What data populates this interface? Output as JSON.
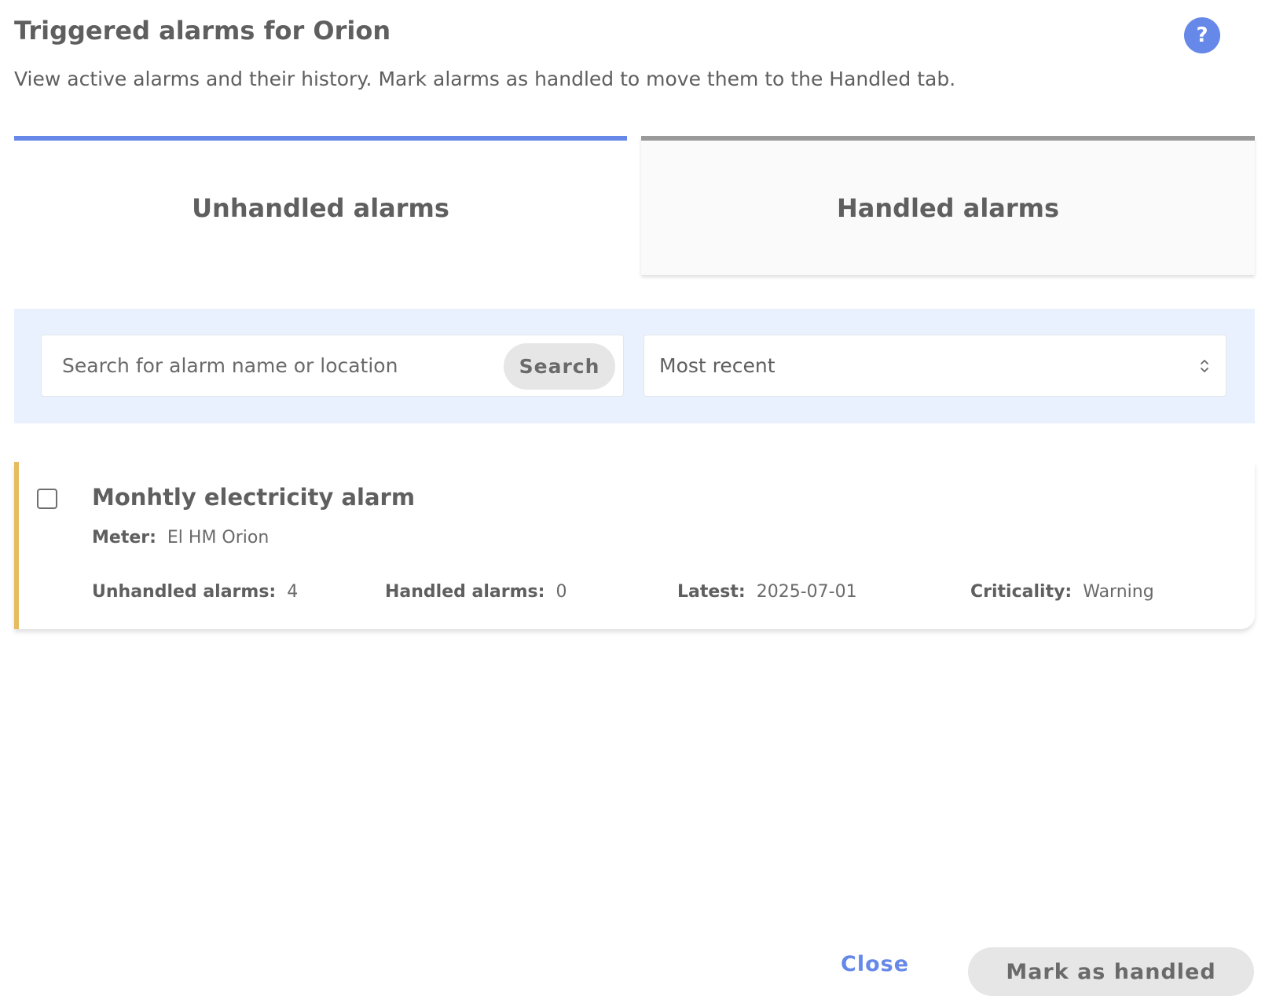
{
  "header": {
    "title": "Triggered alarms for Orion",
    "subtitle": "View active alarms and their history. Mark alarms as handled to move them to the Handled tab.",
    "help_label": "?"
  },
  "tabs": [
    {
      "label": "Unhandled alarms",
      "active": true
    },
    {
      "label": "Handled alarms",
      "active": false
    }
  ],
  "filters": {
    "search_placeholder": "Search for alarm name or location",
    "search_value": "",
    "search_button": "Search",
    "sort_value": "Most recent"
  },
  "alarms": [
    {
      "name": "Monhtly electricity alarm",
      "meter_label": "Meter:",
      "meter_value": "El HM Orion",
      "unhandled_label": "Unhandled alarms:",
      "unhandled_value": "4",
      "handled_label": "Handled alarms:",
      "handled_value": "0",
      "latest_label": "Latest:",
      "latest_value": "2025-07-01",
      "criticality_label": "Criticality:",
      "criticality_value": "Warning",
      "checked": false
    }
  ],
  "footer": {
    "close_label": "Close",
    "mark_label": "Mark as handled"
  },
  "colors": {
    "accent": "#6688e8",
    "warning": "#e5bc5e",
    "filter_background": "#e8f1fd"
  },
  "icons": {
    "help": "question-mark-icon",
    "sort": "chevron-up-down-icon",
    "checkbox": "checkbox-unchecked-icon"
  }
}
